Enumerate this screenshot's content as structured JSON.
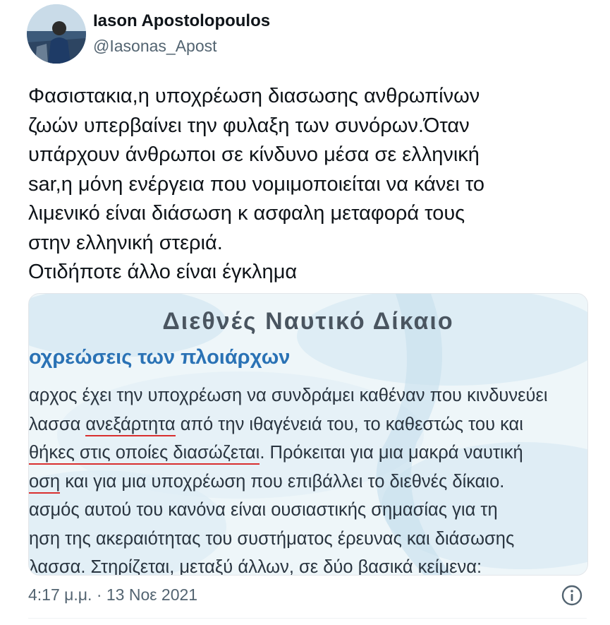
{
  "tweet": {
    "user_name": "Iason Apostolopoulos",
    "user_handle": "@Iasonas_Apost",
    "text_lines": [
      "Φασιστακια,η υποχρέωση διασωσης ανθρωπίνων",
      "ζωών υπερβαίνει την φυλαξη των συνόρων.Όταν",
      "υπάρχουν άνθρωποι σε κίνδυνο μέσα σε ελληνική",
      "sar,η μόνη ενέργεια που νομιμοποιείται να κάνει το",
      "λιμενικό είναι διάσωση κ ασφαλη μεταφορά τους",
      "στην ελληνική στεριά.",
      "Οτιδήποτε άλλο είναι έγκλημα"
    ],
    "timestamp": "4:17 μ.μ. · 13 Νοε 2021"
  },
  "media": {
    "title": "Διεθνές Ναυτικό Δίκαιο",
    "subtitle": "οχρεώσεις των πλοιάρχων",
    "lines": {
      "l1": "αρχος έχει την υποχρέωση να συνδράμει καθέναν που κινδυνεύει",
      "l2a": "λασσα ",
      "l2b": "ανεξάρτητα",
      "l2c": " από την ιθαγένειά του, το καθεστώς του και",
      "l3a": "θήκες στις οποίες διασώζεται",
      "l3b": ". Πρόκειται για μια μακρά ναυτική",
      "l4a": "οση",
      "l4b": " και για μια υποχρέωση που επιβάλλει το διεθνές δίκαιο.",
      "l5": "ασμός αυτού του κανόνα είναι ουσιαστικής σημασίας για τη",
      "l6": "ηση της ακεραιότητας του συστήματος έρευνας και διάσωσης",
      "l7": "λασσα. Στηρίζεται, μεταξύ άλλων, σε δύο βασικά κείμενα:"
    }
  },
  "colors": {
    "handle": "#536471",
    "subtitle_blue": "#2a72b5",
    "underline_red": "#d92f2f",
    "media_background": "#eaf4f8"
  },
  "icons": {
    "info": "info-circle-icon"
  }
}
